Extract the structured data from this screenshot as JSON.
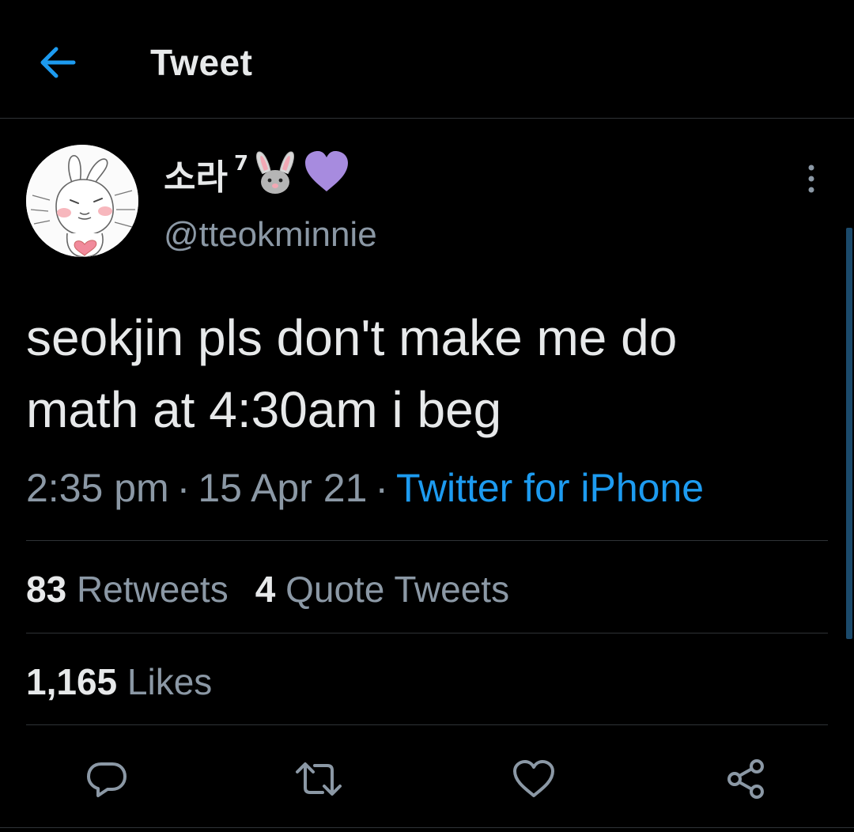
{
  "header": {
    "title": "Tweet",
    "back_icon": "arrow-left-icon",
    "accent_color": "#1d9bf0"
  },
  "tweet": {
    "author": {
      "display_name": "소라",
      "name_superscript": "7",
      "name_emojis": [
        "rabbit-face-emoji",
        "purple-heart-emoji"
      ],
      "handle": "@tteokminnie",
      "avatar": "bunny-drawing-avatar"
    },
    "text": "seokjin pls don't make me do\nmath at 4:30am i beg",
    "time": "2:35 pm",
    "date": "15 Apr 21",
    "separator": "·",
    "source": "Twitter for iPhone",
    "stats": {
      "retweets_count": "83",
      "retweets_label": "Retweets",
      "quotes_count": "4",
      "quotes_label": "Quote Tweets",
      "likes_count": "1,165",
      "likes_label": "Likes"
    }
  },
  "actions": [
    {
      "name": "reply",
      "icon": "reply-bubble-icon"
    },
    {
      "name": "retweet",
      "icon": "retweet-icon"
    },
    {
      "name": "like",
      "icon": "heart-icon"
    },
    {
      "name": "share",
      "icon": "share-icon"
    }
  ],
  "colors": {
    "background": "#000000",
    "text_primary": "#e7e9ea",
    "text_secondary": "#8b98a5",
    "divider": "#2f3336",
    "link": "#1d9bf0",
    "purple_heart": "#a78bdf"
  }
}
